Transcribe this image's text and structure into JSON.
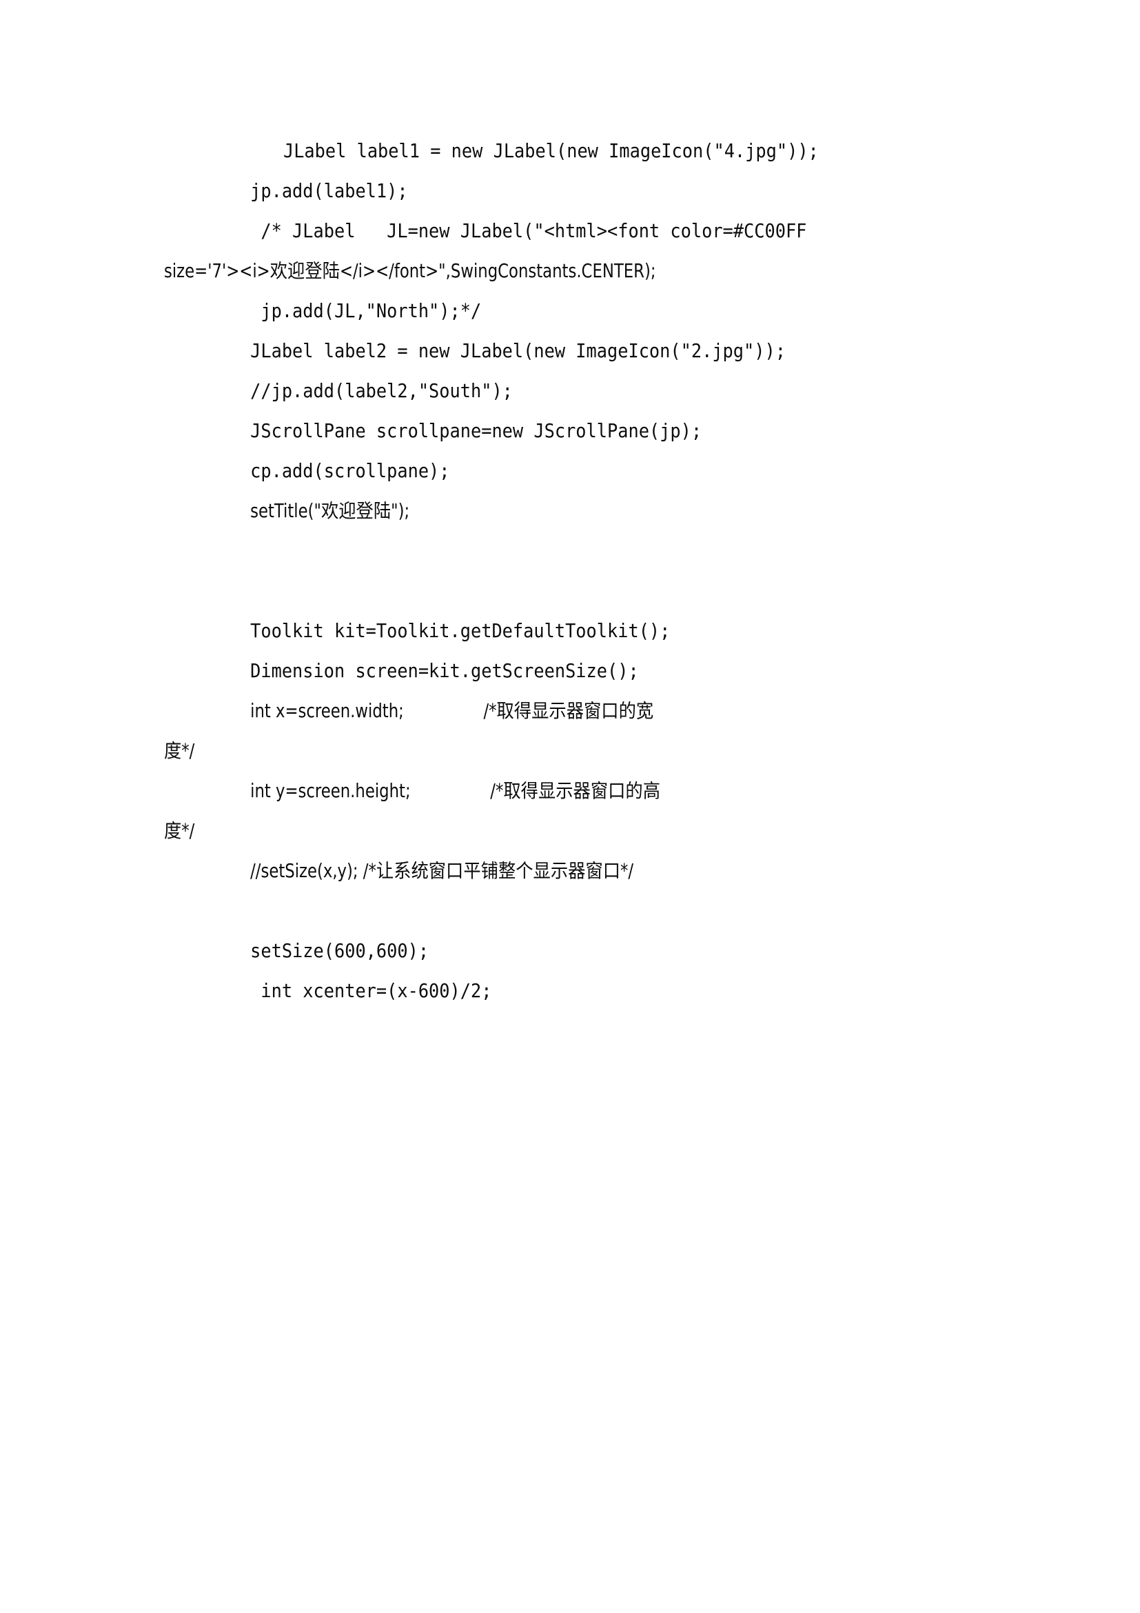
{
  "document": {
    "type": "code-listing",
    "language": "Java",
    "page_background": "#FFFFFF",
    "text_color": "#000000",
    "lines": [
      {
        "id": "l1",
        "text": "JLabel label1 = new JLabel(new ImageIcon(\"4.jpg\"));",
        "indent": "first"
      },
      {
        "id": "l2",
        "text": "jp.add(label1);",
        "indent": "tab"
      },
      {
        "id": "l3",
        "text": " /* JLabel   JL=new JLabel(\"<html><font color=#CC00FF",
        "indent": "tab"
      },
      {
        "id": "l4",
        "text": "size='7'><i>欢迎登陆</i></font>\",SwingConstants.CENTER);",
        "indent": "none"
      },
      {
        "id": "l5",
        "text": " jp.add(JL,\"North\");*/",
        "indent": "tab"
      },
      {
        "id": "l6",
        "text": "JLabel label2 = new JLabel(new ImageIcon(\"2.jpg\"));",
        "indent": "tab"
      },
      {
        "id": "l7",
        "text": "//jp.add(label2,\"South\");",
        "indent": "tab"
      },
      {
        "id": "l8",
        "text": "JScrollPane scrollpane=new JScrollPane(jp);",
        "indent": "tab"
      },
      {
        "id": "l9",
        "text": "cp.add(scrollpane);",
        "indent": "tab"
      },
      {
        "id": "l10",
        "text": "setTitle(\"欢迎登陆\");",
        "indent": "tab"
      },
      {
        "id": "l11",
        "text": "",
        "indent": "none"
      },
      {
        "id": "l12",
        "text": "",
        "indent": "none"
      },
      {
        "id": "l13",
        "text": "Toolkit kit=Toolkit.getDefaultToolkit();",
        "indent": "tab"
      },
      {
        "id": "l14",
        "text": "Dimension screen=kit.getScreenSize();",
        "indent": "tab"
      },
      {
        "id": "l15",
        "text": "int x=screen.width;                /*取得显示器窗口的宽",
        "indent": "tab"
      },
      {
        "id": "l16",
        "text": "度*/",
        "indent": "none"
      },
      {
        "id": "l17",
        "text": "int y=screen.height;                /*取得显示器窗口的高",
        "indent": "tab"
      },
      {
        "id": "l18",
        "text": "度*/",
        "indent": "none"
      },
      {
        "id": "l19",
        "text": "//setSize(x,y); /*让系统窗口平铺整个显示器窗口*/",
        "indent": "tab"
      },
      {
        "id": "l20",
        "text": "",
        "indent": "none"
      },
      {
        "id": "l21",
        "text": "setSize(600,600);",
        "indent": "tab"
      },
      {
        "id": "l22",
        "text": " int xcenter=(x-600)/2;",
        "indent": "tab"
      }
    ]
  }
}
